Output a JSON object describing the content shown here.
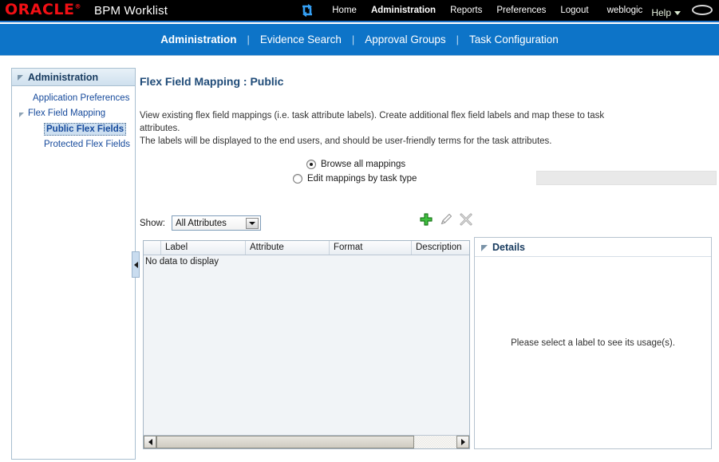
{
  "topbar": {
    "logo_text": "ORACLE",
    "app_title": "BPM Worklist",
    "refresh_icon": "refresh-icon",
    "links": [
      {
        "label": "Home",
        "active": false
      },
      {
        "label": "Administration",
        "active": true
      },
      {
        "label": "Reports",
        "active": false
      },
      {
        "label": "Preferences",
        "active": false
      },
      {
        "label": "Logout",
        "active": false
      }
    ],
    "user": "weblogic",
    "help_label": "Help",
    "help_caret_icon": "chevron-down-icon",
    "balloon_icon": "balloon-icon"
  },
  "navbar": {
    "tabs": [
      {
        "label": "Administration",
        "active": true
      },
      {
        "label": "Evidence Search",
        "active": false
      },
      {
        "label": "Approval Groups",
        "active": false
      },
      {
        "label": "Task Configuration",
        "active": false
      }
    ],
    "separator": "|"
  },
  "sidebar": {
    "header": "Administration",
    "items": [
      {
        "label": "Application Preferences",
        "level": 1,
        "selected": false,
        "has_twisty": false
      },
      {
        "label": "Flex Field Mapping",
        "level": 1,
        "selected": false,
        "has_twisty": true
      },
      {
        "label": "Public Flex Fields",
        "level": 2,
        "selected": true,
        "has_twisty": false
      },
      {
        "label": "Protected Flex Fields",
        "level": 2,
        "selected": false,
        "has_twisty": false
      }
    ]
  },
  "main": {
    "page_title": "Flex Field Mapping : Public",
    "description_line1": "View existing flex field mappings (i.e. task attribute labels). Create additional flex field labels and map these to task attributes.",
    "description_line2": "The labels will be displayed to the end users, and should be user-friendly terms for the task attributes.",
    "radios": [
      {
        "label": "Browse all mappings",
        "selected": true
      },
      {
        "label": "Edit mappings by task type",
        "selected": false
      }
    ],
    "task_type_field_value": "",
    "show_label": "Show:",
    "show_selected": "All Attributes",
    "toolbar": [
      {
        "name": "add-icon",
        "tooltip": "Add"
      },
      {
        "name": "edit-pencil-icon",
        "tooltip": "Edit"
      },
      {
        "name": "delete-x-icon",
        "tooltip": "Delete"
      }
    ],
    "table": {
      "columns": [
        "",
        "Label",
        "Attribute",
        "Format",
        "Description"
      ],
      "rows": [],
      "empty_message": "No data to display"
    },
    "details": {
      "title": "Details",
      "empty_message": "Please select a label to see its usage(s)."
    }
  },
  "colors": {
    "brand_red": "#f20f14",
    "nav_blue": "#0d74c8",
    "topbar_black": "#000000",
    "heading_blue": "#1f4b78",
    "link_blue": "#15499b",
    "add_green": "#3aa83a"
  }
}
